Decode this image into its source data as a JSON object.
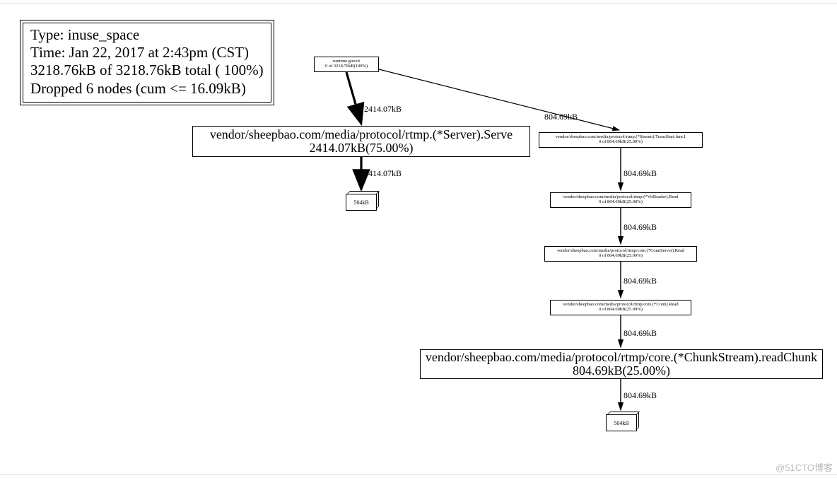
{
  "legend": {
    "type_line": "Type: inuse_space",
    "time_line": "Time: Jan 22, 2017 at 2:43pm (CST)",
    "total_line": "3218.76kB of 3218.76kB total (  100%)",
    "dropped_line": "Dropped 6 nodes (cum <= 16.09kB)"
  },
  "nodes": {
    "root": {
      "line1": "runtime.goexit",
      "line2": "0 of 3218.76kB(100%)"
    },
    "serve": {
      "line1": "vendor/sheepbao.com/media/protocol/rtmp.(*Server).Serve",
      "line2": "2414.07kB(75.00%)"
    },
    "transstart": {
      "line1": "vendor/sheepbao.com/media/protocol/rtmp.(*Stream).TransStart.func1",
      "line2": "0 of 804.69kB(25.00%)"
    },
    "virreader": {
      "line1": "vendor/sheepbao.com/media/protocol/rtmp.(*VirReader).Read",
      "line2": "0 of 804.69kB(25.00%)"
    },
    "connserver": {
      "line1": "vendor/sheepbao.com/media/protocol/rtmp/core.(*ConnServer).Read",
      "line2": "0 of 804.69kB(25.00%)"
    },
    "conn": {
      "line1": "vendor/sheepbao.com/media/protocol/rtmp/core.(*Conn).Read",
      "line2": "0 of 804.69kB(25.00%)"
    },
    "chunkstream": {
      "line1": "vendor/sheepbao.com/media/protocol/rtmp/core.(*ChunkStream).readChunk",
      "line2": "804.69kB(25.00%)"
    },
    "cube_left": "504kB",
    "cube_right": "504kB"
  },
  "edges": {
    "root_serve": "2414.07kB",
    "root_transstart": "804.69kB",
    "serve_cube": "2414.07kB",
    "transstart_virreader": "804.69kB",
    "virreader_connserver": "804.69kB",
    "connserver_conn": "804.69kB",
    "conn_chunkstream": "804.69kB",
    "chunkstream_cube": "804.69kB"
  },
  "watermark": "@51CTO博客"
}
